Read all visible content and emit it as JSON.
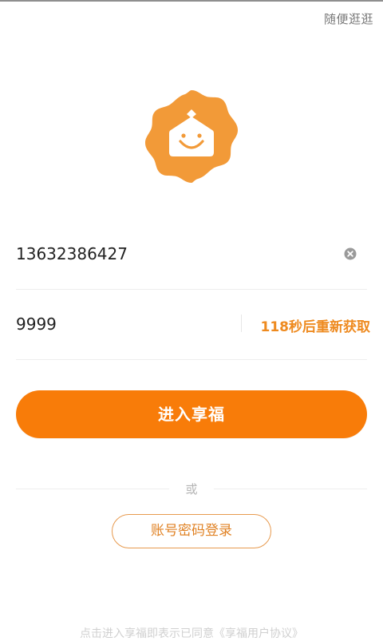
{
  "header": {
    "browse_link": "随便逛逛"
  },
  "login_form": {
    "phone_value": "13632386427",
    "code_value": "9999",
    "resend_countdown": "118秒后重新获取",
    "submit_label": "进入享福"
  },
  "alternate": {
    "or_label": "或",
    "account_login_label": "账号密码登录"
  },
  "footer": {
    "agreement_prefix": "点击进入享福即表示已同意",
    "agreement_link": "《享福用户协议》"
  },
  "colors": {
    "accent": "#f87c09",
    "logo_orange": "#f29a38",
    "countdown": "#ee8a1f",
    "outline": "#e79a4f",
    "muted_text": "#b5b5b5"
  },
  "icons": {
    "logo": "smiling-house-badge-icon",
    "clear": "clear-circle-icon"
  }
}
